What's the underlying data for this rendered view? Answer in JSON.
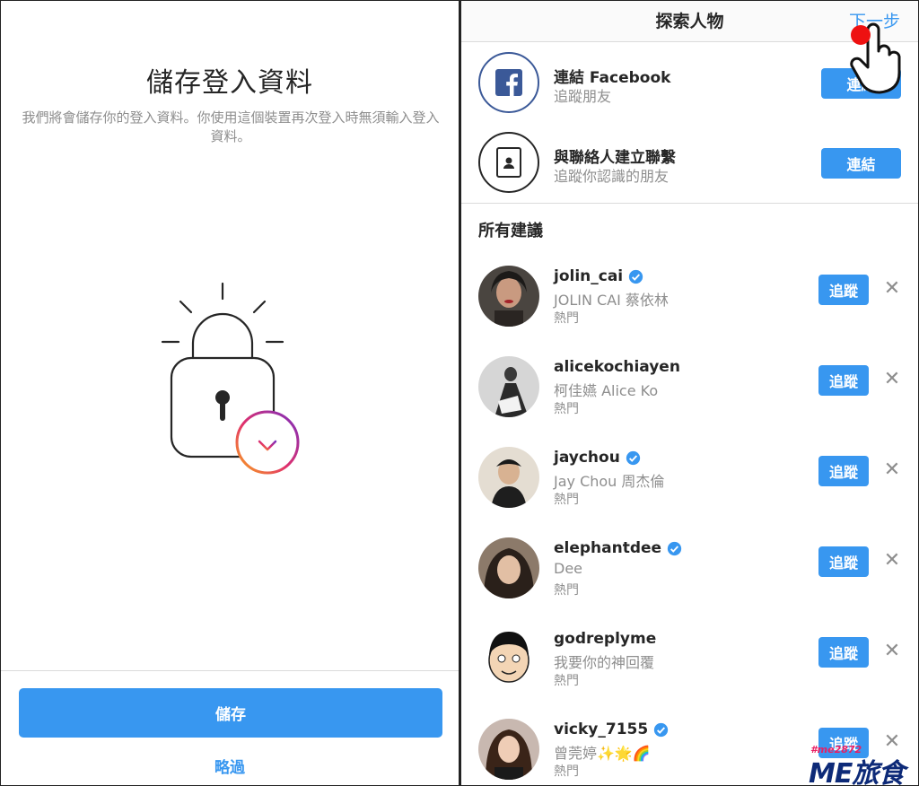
{
  "save_login": {
    "title": "儲存登入資料",
    "description": "我們將會儲存你的登入資料。你使用這個裝置再次登入時無須輸入登入資料。",
    "save_label": "儲存",
    "skip_label": "略過",
    "accent": "#3897f0"
  },
  "discover": {
    "title": "探索人物",
    "next_label": "下一步",
    "connect": [
      {
        "name": "連結 Facebook",
        "subtitle": "追蹤朋友",
        "button": "連結",
        "icon": "facebook-icon"
      },
      {
        "name": "與聯絡人建立聯繫",
        "subtitle": "追蹤你認識的朋友",
        "button": "連結",
        "icon": "contacts-icon"
      }
    ],
    "section_title": "所有建議",
    "follow_label": "追蹤",
    "dismiss_label": "✕",
    "suggestions": [
      {
        "username": "jolin_cai",
        "name": "JOLIN CAI 蔡依林",
        "tag": "熱門",
        "verified": true
      },
      {
        "username": "alicekochiayen",
        "name": "柯佳嬿 Alice Ko",
        "tag": "熱門",
        "verified": false
      },
      {
        "username": "jaychou",
        "name": "Jay Chou 周杰倫",
        "tag": "熱門",
        "verified": true
      },
      {
        "username": "elephantdee",
        "name": "Dee",
        "tag": "熱門",
        "verified": true
      },
      {
        "username": "godreplyme",
        "name": "我要你的神回覆",
        "tag": "熱門",
        "verified": false
      },
      {
        "username": "vicky_7155",
        "name": "曾莞婷✨🌟🌈",
        "tag": "熱門",
        "verified": true
      }
    ]
  },
  "watermark": {
    "small": "#me2872",
    "big": "ME旅食"
  }
}
